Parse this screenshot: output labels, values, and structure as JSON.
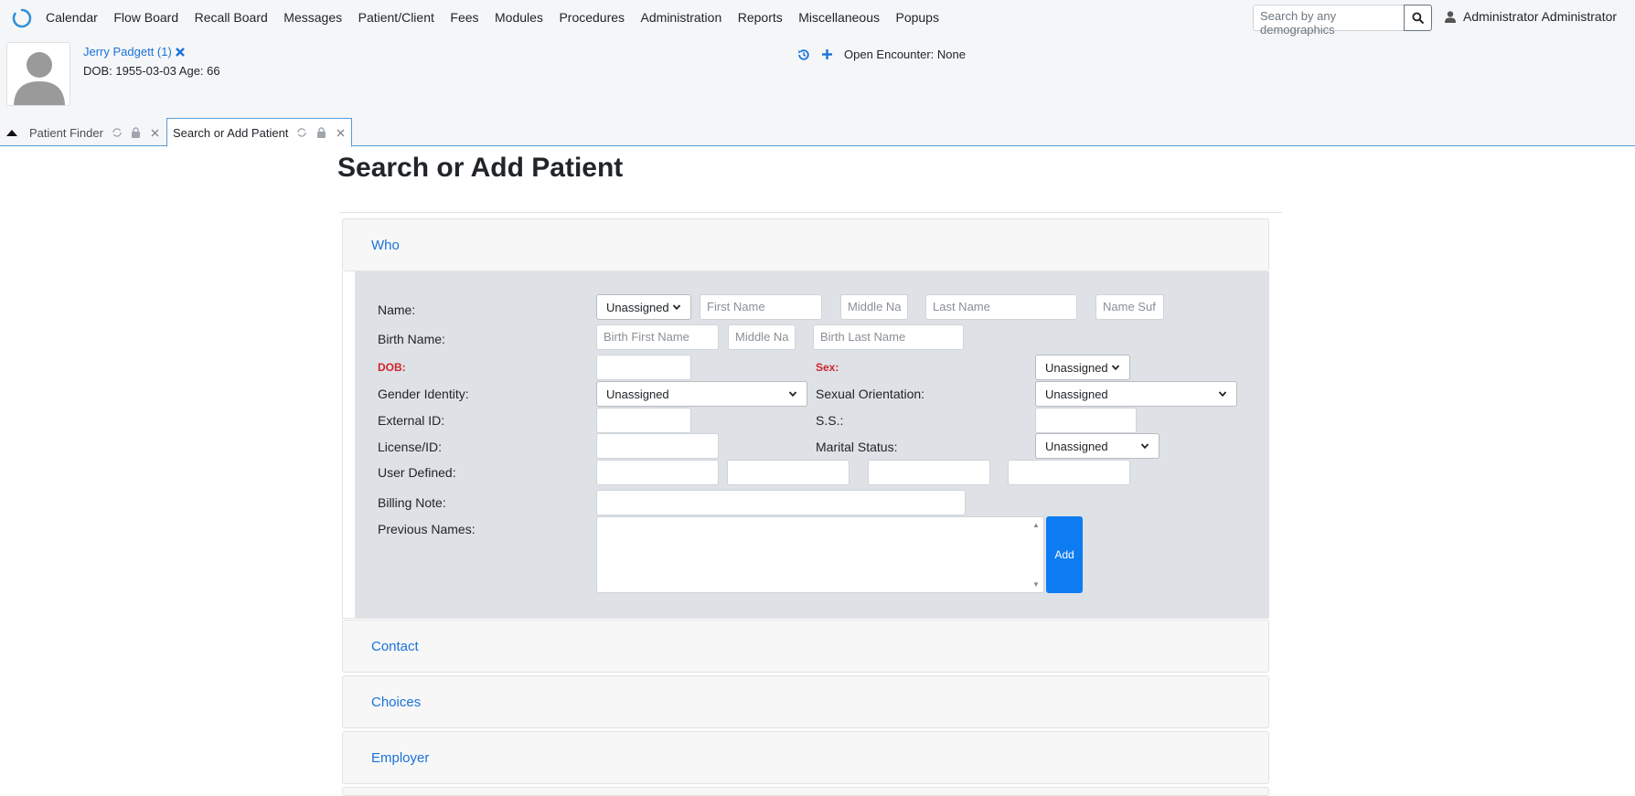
{
  "nav": {
    "items": [
      "Calendar",
      "Flow Board",
      "Recall Board",
      "Messages",
      "Patient/Client",
      "Fees",
      "Modules",
      "Procedures",
      "Administration",
      "Reports",
      "Miscellaneous",
      "Popups"
    ],
    "search_placeholder": "Search by any demographics",
    "user": "Administrator Administrator"
  },
  "patient": {
    "name": "Jerry Padgett (1)",
    "dob_line": "DOB: 1955-03-03 Age: 66"
  },
  "encounter": {
    "label": "Open Encounter: None"
  },
  "tabs": [
    {
      "label": "Patient Finder"
    },
    {
      "label": "Search or Add Patient"
    }
  ],
  "page": {
    "title": "Search or Add Patient"
  },
  "accordion": {
    "who": "Who",
    "contact": "Contact",
    "choices": "Choices",
    "employer": "Employer"
  },
  "form": {
    "labels": {
      "name": "Name:",
      "birth_name": "Birth Name:",
      "dob": "DOB:",
      "sex": "Sex:",
      "gender_identity": "Gender Identity:",
      "sexual_orientation": "Sexual Orientation:",
      "external_id": "External ID:",
      "ss": "S.S.:",
      "license": "License/ID:",
      "marital": "Marital Status:",
      "user_defined": "User Defined:",
      "billing_note": "Billing Note:",
      "previous_names": "Previous Names:"
    },
    "placeholders": {
      "first_name": "First Name",
      "middle_name": "Middle Na",
      "last_name": "Last Name",
      "name_suffix": "Name Suf",
      "birth_first": "Birth First Name",
      "birth_middle": "Middle Na",
      "birth_last": "Birth Last Name"
    },
    "selects": {
      "title": "Unassigned",
      "sex": "Unassigned",
      "gender_identity": "Unassigned",
      "sexual_orientation": "Unassigned",
      "marital": "Unassigned"
    },
    "add_button": "Add"
  },
  "colors": {
    "accent": "#0d7cf2",
    "link": "#1a73d9",
    "required": "#d2232a",
    "panel": "#dee1e6"
  }
}
